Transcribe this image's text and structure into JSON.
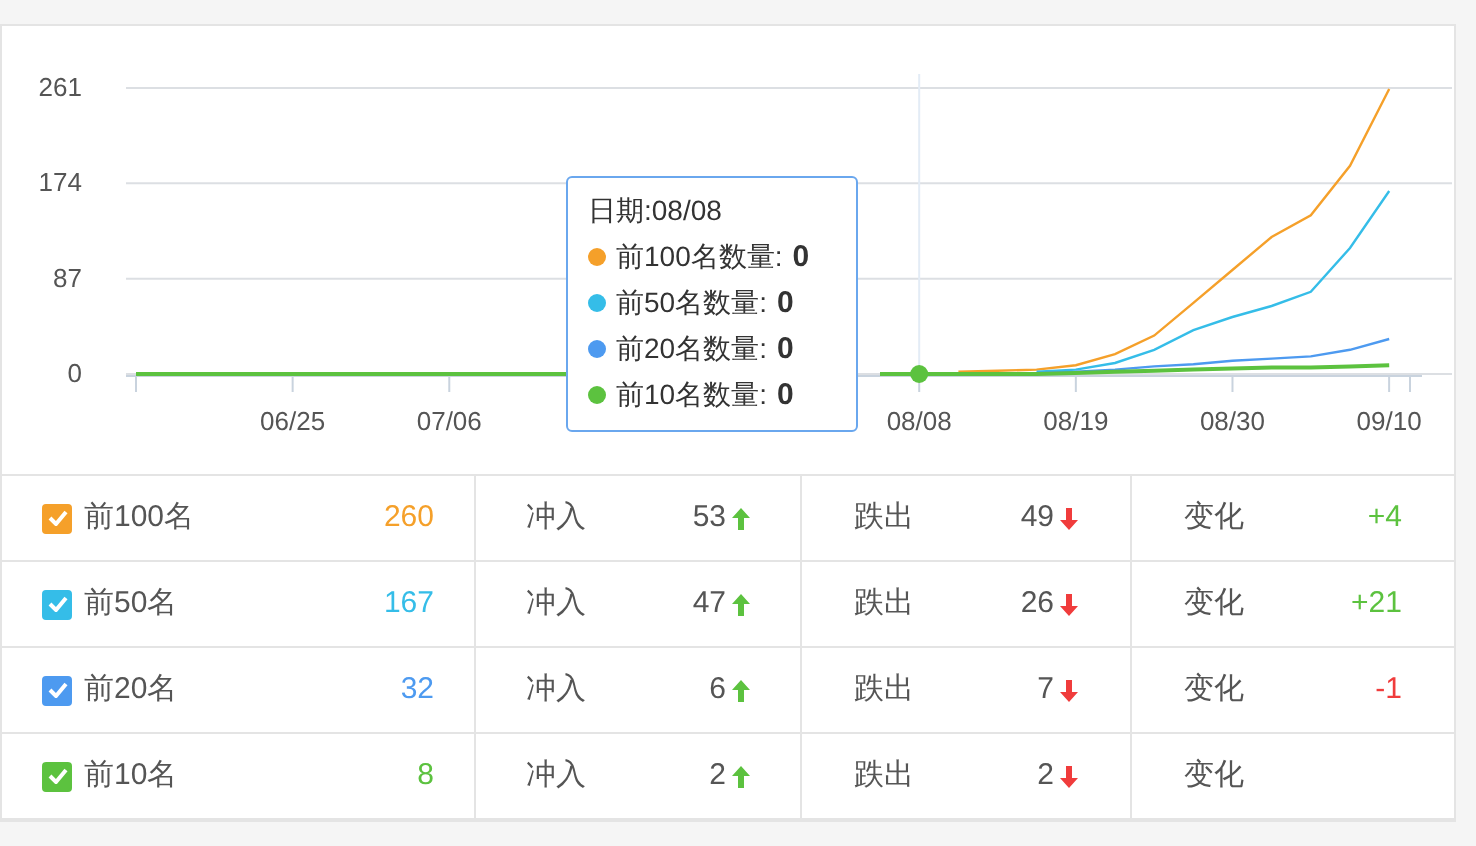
{
  "chart": {
    "chart_data": {
      "type": "line",
      "categories": [
        null,
        null,
        null,
        null,
        "06/25",
        null,
        null,
        null,
        "07/06",
        null,
        null,
        null,
        null,
        null,
        null,
        null,
        null,
        null,
        null,
        null,
        "08/08",
        null,
        null,
        null,
        "08/19",
        null,
        null,
        null,
        "08/30",
        null,
        null,
        null,
        "09/10"
      ],
      "series": [
        {
          "color": "#f5a02a",
          "values": [
            null,
            null,
            null,
            null,
            null,
            null,
            null,
            null,
            null,
            null,
            null,
            null,
            null,
            null,
            null,
            null,
            null,
            null,
            null,
            null,
            null,
            2,
            3,
            4,
            8,
            18,
            35,
            65,
            95,
            125,
            145,
            190,
            260
          ]
        },
        {
          "color": "#35bde8",
          "values": [
            null,
            null,
            null,
            null,
            null,
            null,
            null,
            null,
            null,
            null,
            null,
            null,
            null,
            null,
            null,
            null,
            null,
            null,
            null,
            null,
            null,
            null,
            null,
            2,
            4,
            10,
            22,
            40,
            52,
            62,
            75,
            115,
            167
          ]
        },
        {
          "color": "#4d9af0",
          "values": [
            null,
            null,
            null,
            null,
            null,
            null,
            null,
            null,
            null,
            null,
            null,
            null,
            null,
            null,
            null,
            null,
            null,
            null,
            null,
            null,
            null,
            null,
            null,
            1,
            2,
            4,
            7,
            9,
            12,
            14,
            16,
            22,
            32
          ]
        },
        {
          "color": "#5cc23f",
          "values": [
            0,
            0,
            0,
            0,
            0,
            0,
            0,
            0,
            0,
            0,
            0,
            0,
            null,
            null,
            null,
            null,
            null,
            null,
            null,
            0,
            0,
            0,
            0,
            0,
            1,
            2,
            3,
            4,
            5,
            6,
            6,
            7,
            8
          ]
        }
      ],
      "ylim": [
        0,
        261
      ],
      "yticks": [
        0,
        87,
        174,
        261
      ]
    },
    "tooltip": {
      "title": "日期:08/08",
      "items": [
        {
          "label": "前100名数量:",
          "value": "0",
          "color": "#f5a02a"
        },
        {
          "label": "前50名数量:",
          "value": "0",
          "color": "#35bde8"
        },
        {
          "label": "前20名数量:",
          "value": "0",
          "color": "#4d9af0"
        },
        {
          "label": "前10名数量:",
          "value": "0",
          "color": "#5cc23f"
        }
      ]
    }
  },
  "table": {
    "rows": [
      {
        "label": "前100名",
        "checked": true,
        "color": "#f5a02a",
        "count": "260",
        "in_label": "冲入",
        "in_value": "53",
        "out_label": "跌出",
        "out_value": "49",
        "change": {
          "label": "变化",
          "value": "+4",
          "color": "#5cc23f"
        }
      },
      {
        "label": "前50名",
        "checked": true,
        "color": "#35bde8",
        "count": "167",
        "in_label": "冲入",
        "in_value": "47",
        "out_label": "跌出",
        "out_value": "26",
        "change": {
          "label": "变化",
          "value": "+21",
          "color": "#5cc23f"
        }
      },
      {
        "label": "前20名",
        "checked": true,
        "color": "#4d9af0",
        "count": "32",
        "in_label": "冲入",
        "in_value": "6",
        "out_label": "跌出",
        "out_value": "7",
        "change": {
          "label": "变化",
          "value": "-1",
          "color": "#f03c3c"
        }
      },
      {
        "label": "前10名",
        "checked": true,
        "color": "#5cc23f",
        "count": "8",
        "in_label": "冲入",
        "in_value": "2",
        "out_label": "跌出",
        "out_value": "2",
        "change": {
          "label": "变化"
        }
      }
    ]
  }
}
